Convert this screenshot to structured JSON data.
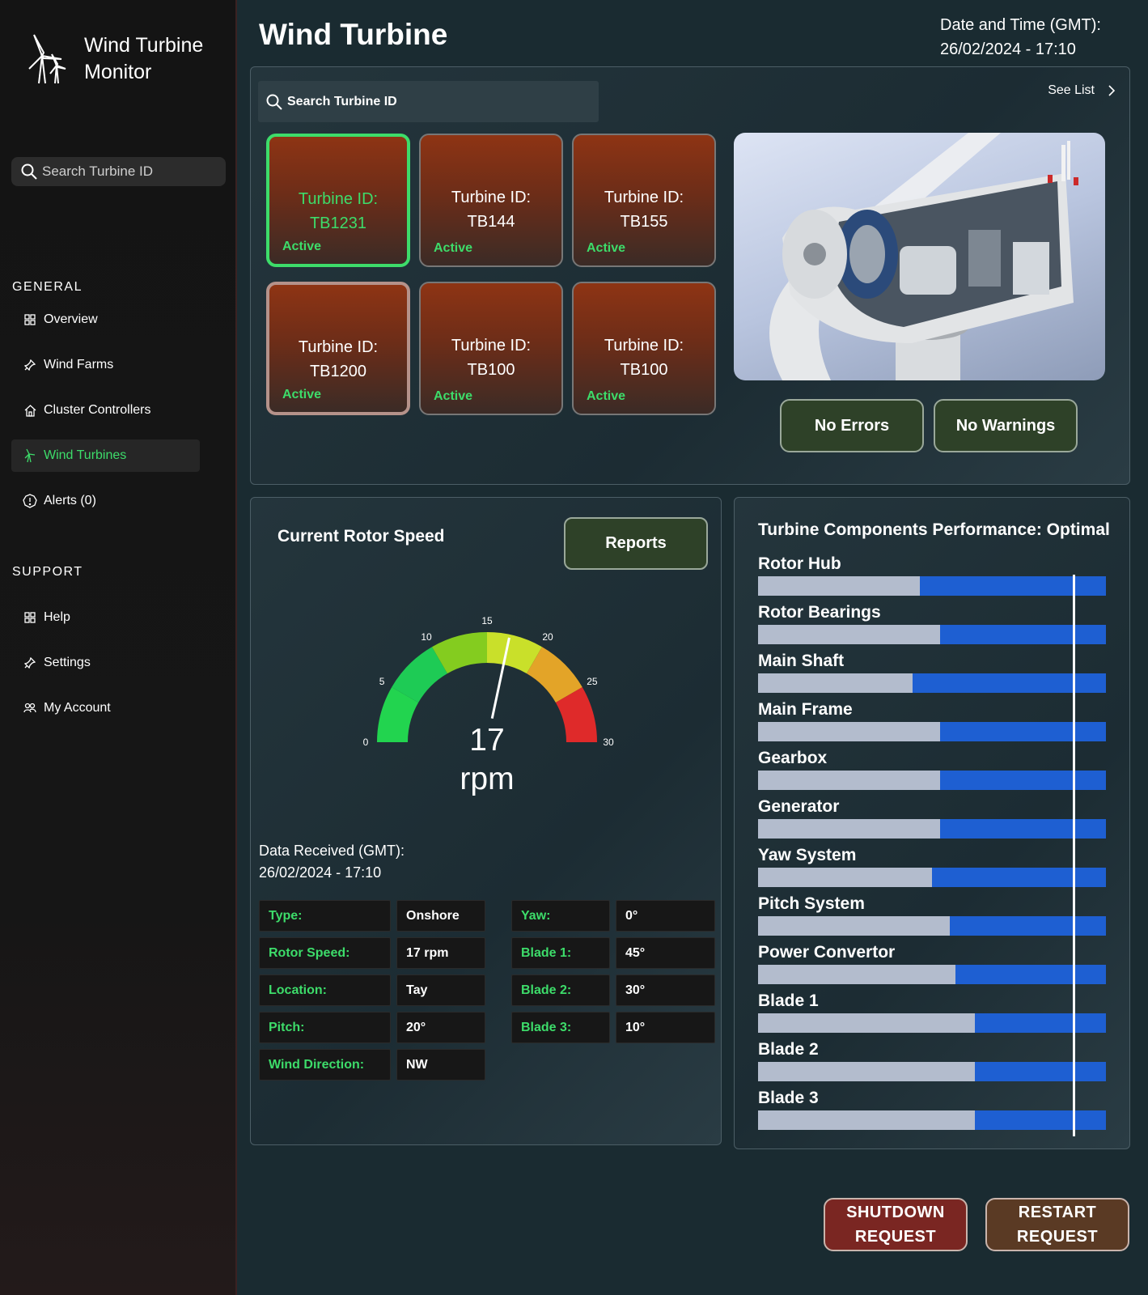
{
  "app": {
    "title": "Wind Turbine Monitor",
    "logo_icon": "wind-turbine-icon"
  },
  "sidebar": {
    "search_placeholder": "Search Turbine ID",
    "general_heading": "GENERAL",
    "general_items": [
      {
        "label": "Overview",
        "icon": "grid-icon",
        "active": false
      },
      {
        "label": "Wind Farms",
        "icon": "pin-icon",
        "active": false
      },
      {
        "label": "Cluster Controllers",
        "icon": "home-icon",
        "active": false
      },
      {
        "label": "Wind Turbines",
        "icon": "wind-turbine-icon",
        "active": true
      },
      {
        "label": "Alerts (0)",
        "icon": "alert-icon",
        "active": false
      }
    ],
    "support_heading": "SUPPORT",
    "support_items": [
      {
        "label": "Help",
        "icon": "grid-icon"
      },
      {
        "label": "Settings",
        "icon": "pin-icon"
      },
      {
        "label": "My Account",
        "icon": "users-icon"
      }
    ]
  },
  "header": {
    "title": "Wind Turbine",
    "datetime_label": "Date and Time (GMT):",
    "datetime_value": "26/02/2024 - 17:10"
  },
  "turbine_panel": {
    "search_placeholder": "Search Turbine ID",
    "see_list_label": "See List",
    "turbines": [
      {
        "line1": "Turbine ID:",
        "line2": "TB1231",
        "status": "Active",
        "selected": true
      },
      {
        "line1": "Turbine ID:",
        "line2": "TB144",
        "status": "Active",
        "selected": false
      },
      {
        "line1": "Turbine ID:",
        "line2": "TB155",
        "status": "Active",
        "selected": false
      },
      {
        "line1": "Turbine ID:",
        "line2": "TB1200",
        "status": "Active",
        "selected": false
      },
      {
        "line1": "Turbine ID:",
        "line2": "TB100",
        "status": "Active",
        "selected": false
      },
      {
        "line1": "Turbine ID:",
        "line2": "TB100",
        "status": "Active",
        "selected": false
      }
    ],
    "errors_label": "No Errors",
    "warnings_label": "No Warnings"
  },
  "rotor": {
    "title": "Current Rotor Speed",
    "reports_label": "Reports",
    "speed_value": "17",
    "speed_unit": "rpm",
    "gauge_min": 0,
    "gauge_max": 30,
    "gauge_ticks": [
      "0",
      "5",
      "10",
      "15",
      "20",
      "25",
      "30"
    ],
    "gauge_reading": 17,
    "gauge_colors": [
      "#22d44f",
      "#1ecb55",
      "#84cc1f",
      "#c9e02a",
      "#e3a428",
      "#df2a2a"
    ],
    "data_received_label": "Data Received (GMT):",
    "data_received_value": "26/02/2024 - 17:10",
    "details_left": [
      {
        "key": "Type:",
        "value": "Onshore"
      },
      {
        "key": "Rotor Speed:",
        "value": "17 rpm"
      },
      {
        "key": "Location:",
        "value": "Tay"
      },
      {
        "key": "Pitch:",
        "value": "20°"
      },
      {
        "key": "Wind Direction:",
        "value": "NW"
      }
    ],
    "details_right": [
      {
        "key": "Yaw:",
        "value": "0°"
      },
      {
        "key": "Blade 1:",
        "value": "45°"
      },
      {
        "key": "Blade 2:",
        "value": "30°"
      },
      {
        "key": "Blade 3:",
        "value": "10°"
      }
    ]
  },
  "components": {
    "title": "Turbine Components Performance: Optimal",
    "marker_level": 0.905,
    "items": [
      {
        "name": "Rotor Hub",
        "level": 0.465
      },
      {
        "name": "Rotor Bearings",
        "level": 0.523
      },
      {
        "name": "Main Shaft",
        "level": 0.444
      },
      {
        "name": "Main Frame",
        "level": 0.523
      },
      {
        "name": "Gearbox",
        "level": 0.523
      },
      {
        "name": "Generator",
        "level": 0.523
      },
      {
        "name": "Yaw System",
        "level": 0.5
      },
      {
        "name": "Pitch System",
        "level": 0.551
      },
      {
        "name": "Power Convertor",
        "level": 0.567
      },
      {
        "name": "Blade 1",
        "level": 0.623
      },
      {
        "name": "Blade 2",
        "level": 0.623
      },
      {
        "name": "Blade 3",
        "level": 0.623
      }
    ]
  },
  "actions": {
    "shutdown_line1": "SHUTDOWN",
    "shutdown_line2": "REQUEST",
    "restart_line1": "RESTART",
    "restart_line2": "REQUEST"
  }
}
